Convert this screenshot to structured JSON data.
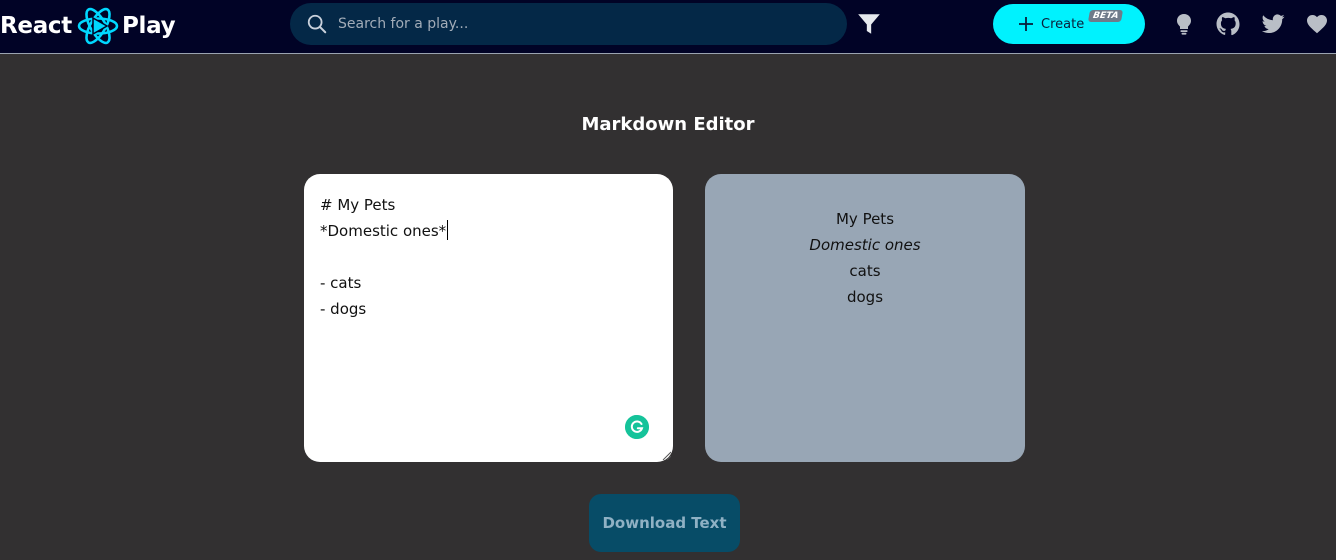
{
  "header": {
    "logo_left": "React",
    "logo_right": "Play",
    "search_placeholder": "Search for a play...",
    "create_label": "Create",
    "beta_badge": "BETA",
    "icons": [
      "lightbulb-icon",
      "github-icon",
      "twitter-icon",
      "heart-icon"
    ]
  },
  "main": {
    "title": "Markdown Editor",
    "editor_lines": [
      "# My Pets",
      "*Domestic ones*",
      "",
      "- cats",
      "- dogs"
    ],
    "preview": {
      "heading": "My Pets",
      "emphasis": "Domestic ones",
      "items": [
        "cats",
        "dogs"
      ]
    },
    "download_label": "Download Text"
  },
  "colors": {
    "header_bg": "#010326",
    "page_bg": "#323031",
    "search_bg": "#042847",
    "accent": "#00f2fe",
    "preview_bg": "#98a6b5",
    "download_bg": "#074c67",
    "grammarly": "#15c39a"
  }
}
